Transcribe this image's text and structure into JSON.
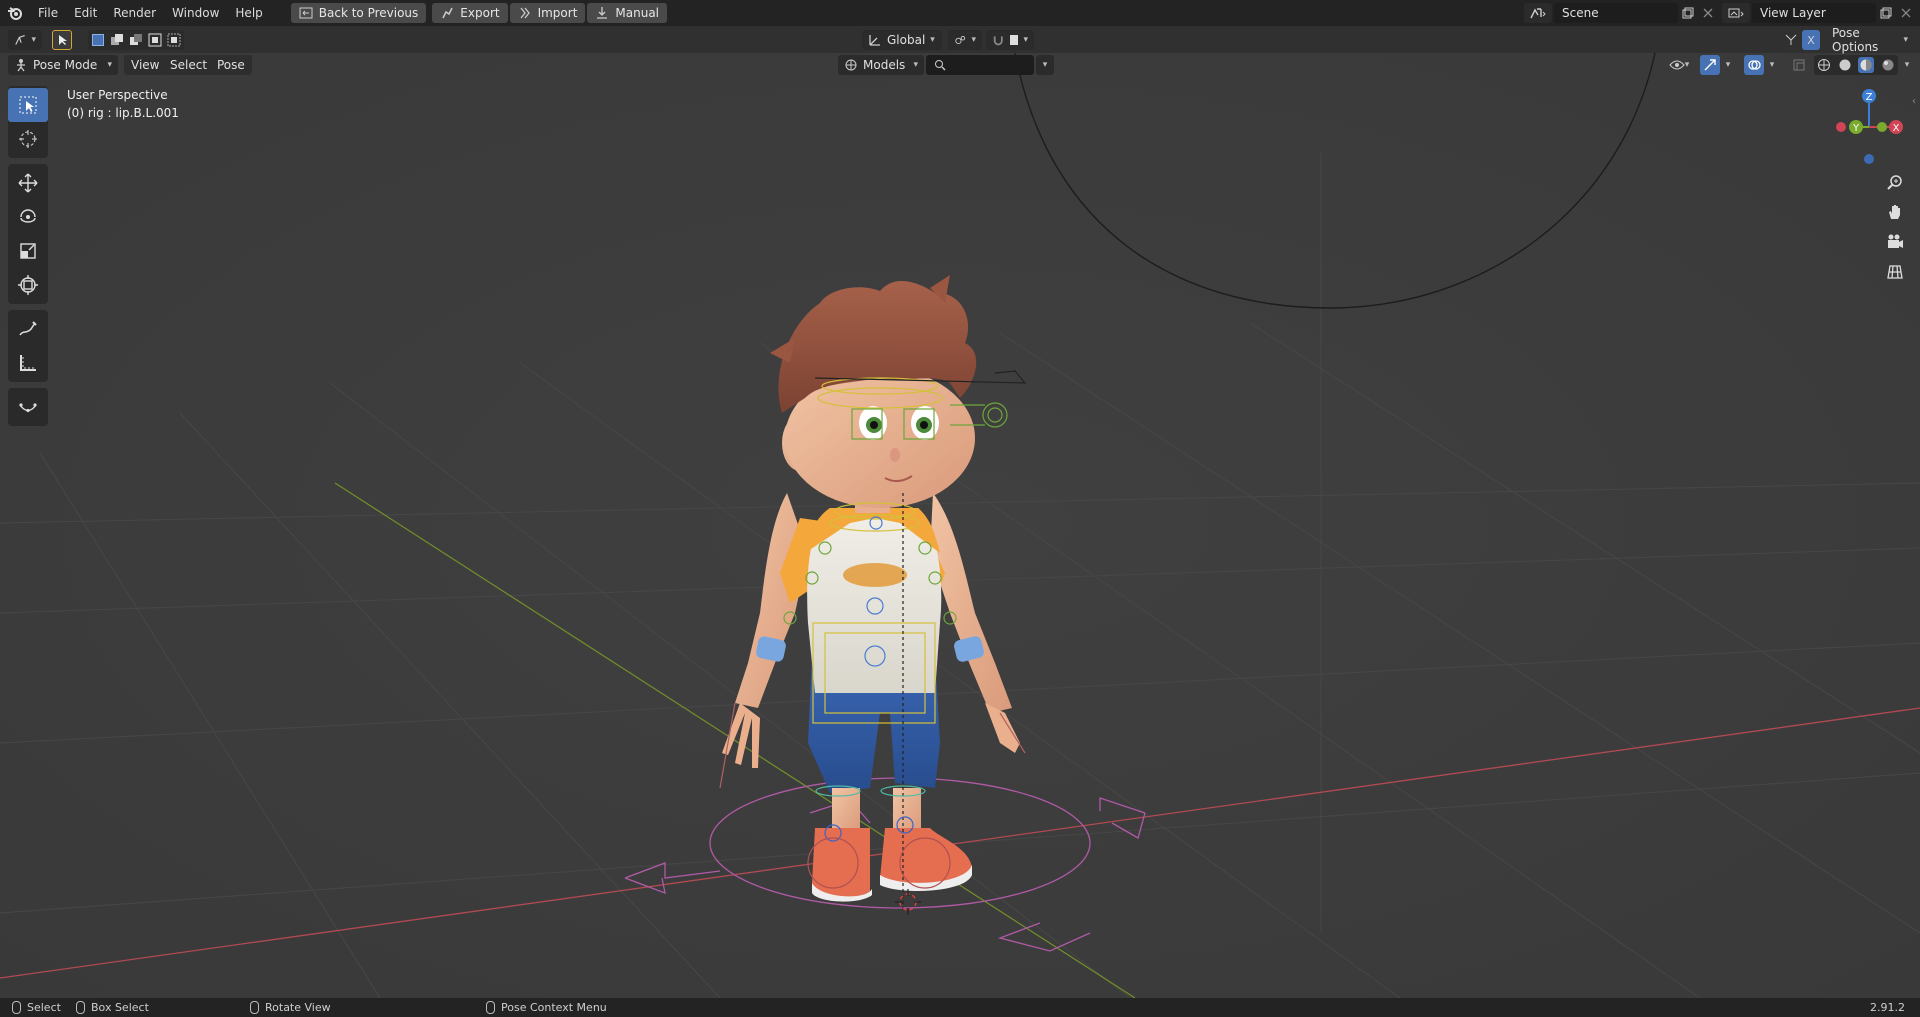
{
  "menu": [
    "File",
    "Edit",
    "Render",
    "Window",
    "Help"
  ],
  "topbar": {
    "back_label": "Back to Previous",
    "export_label": "Export",
    "import_label": "Import",
    "manual_label": "Manual",
    "scene_value": "Scene",
    "view_layer_value": "View Layer"
  },
  "toolheader": {
    "orientation": "Global",
    "pose_options": "Pose Options",
    "x_mirror": "X"
  },
  "viewheader": {
    "mode": "Pose Mode",
    "menus": [
      "View",
      "Select",
      "Pose"
    ],
    "collection": "Models",
    "search_value": ""
  },
  "viewport": {
    "perspective": "User Perspective",
    "active": "(0) rig : lip.B.L.001"
  },
  "gizmo": {
    "z": "Z",
    "y": "Y",
    "x": "X"
  },
  "statusbar": {
    "select": "Select",
    "box_select": "Box Select",
    "rotate_view": "Rotate View",
    "context_menu": "Pose Context Menu",
    "version": "2.91.2"
  },
  "colors": {
    "accent": "#4772b3",
    "axis_x": "#c24a54",
    "axis_y": "#7a9a2e",
    "viewport_bg": "#3d3d3d"
  }
}
